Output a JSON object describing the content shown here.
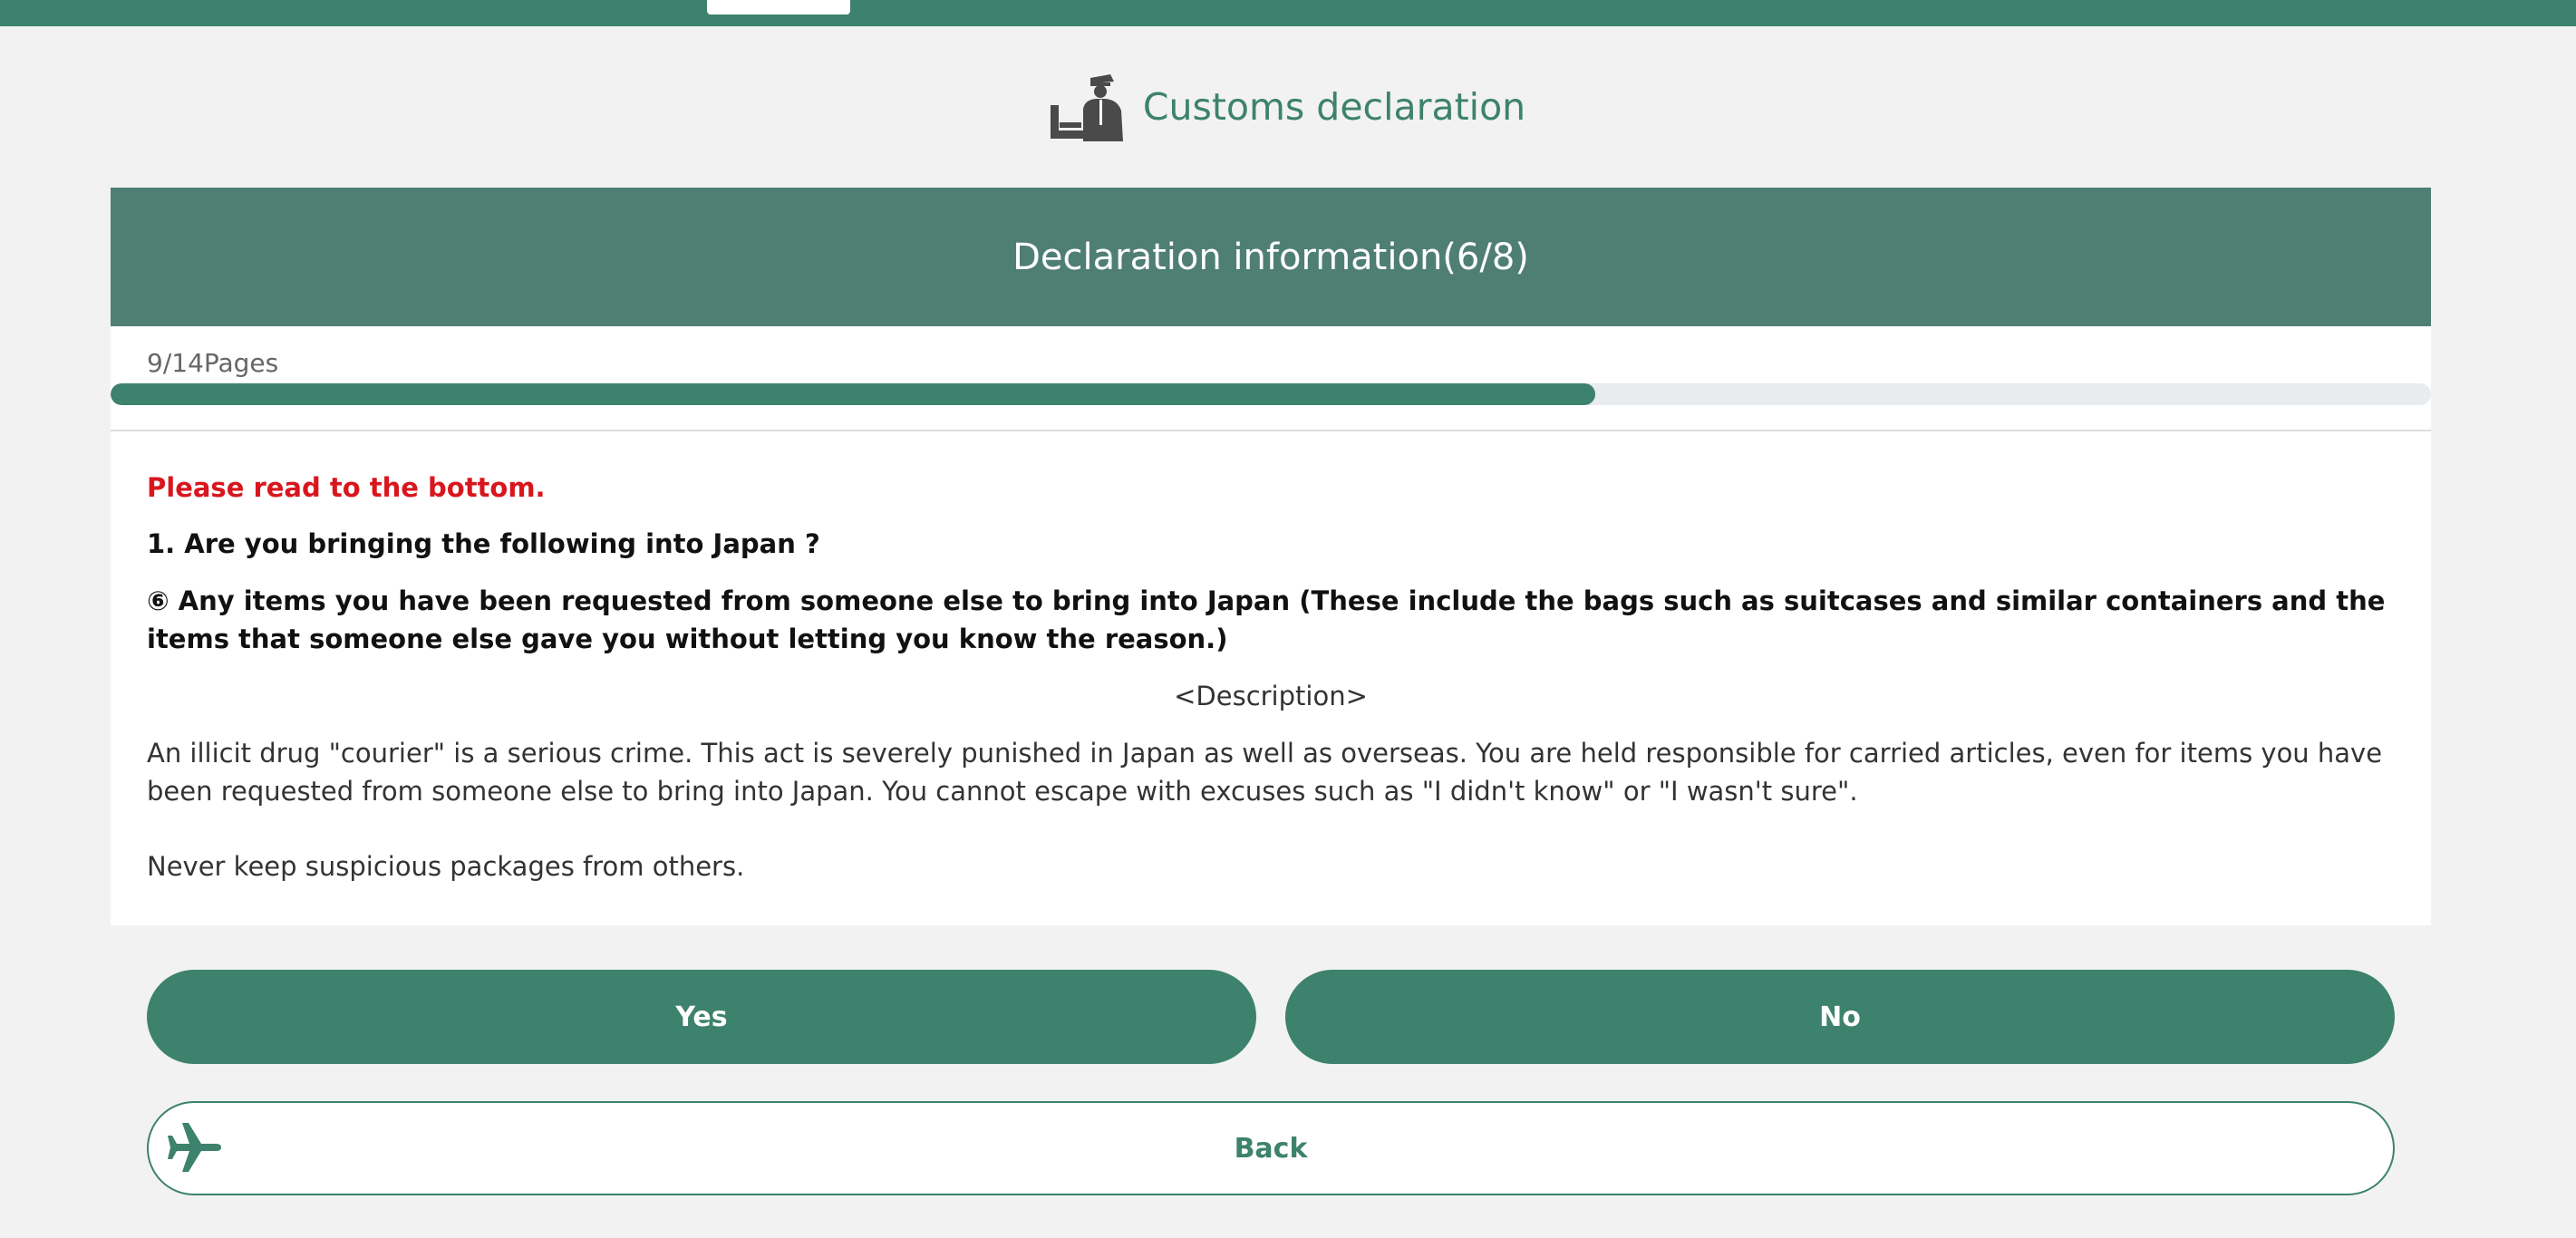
{
  "header": {
    "title": "Customs declaration",
    "icon": "customs-officer-icon"
  },
  "card": {
    "title": "Declaration information(6/8)"
  },
  "progress": {
    "label": "9/14Pages",
    "fraction": 0.64
  },
  "content": {
    "warning": "Please read to the bottom.",
    "question": "1. Are you bringing the following into Japan ?",
    "subquestion": "⑥ Any items you have been requested from someone else to bring into Japan (These include the bags such as suitcases and similar containers and the items that someone else gave you without letting you know the reason.)",
    "description_heading": "<Description>",
    "description_text": "An illicit drug \"courier\" is a serious crime. This act is severely punished in Japan as well as overseas. You are held responsible for carried articles, even for items you have been requested from someone else to bring into Japan. You cannot escape with excuses such as \"I didn't know\" or \"I wasn't sure\".",
    "description_note": "Never keep suspicious packages from others."
  },
  "buttons": {
    "yes": "Yes",
    "no": "No",
    "back": "Back",
    "back_icon": "airplane-icon"
  },
  "colors": {
    "brand_green": "#3d826c",
    "header_green": "#4f7f72",
    "warning_red": "#d9161d",
    "background": "#f2f2f2",
    "progress_track": "#e8ecee"
  }
}
